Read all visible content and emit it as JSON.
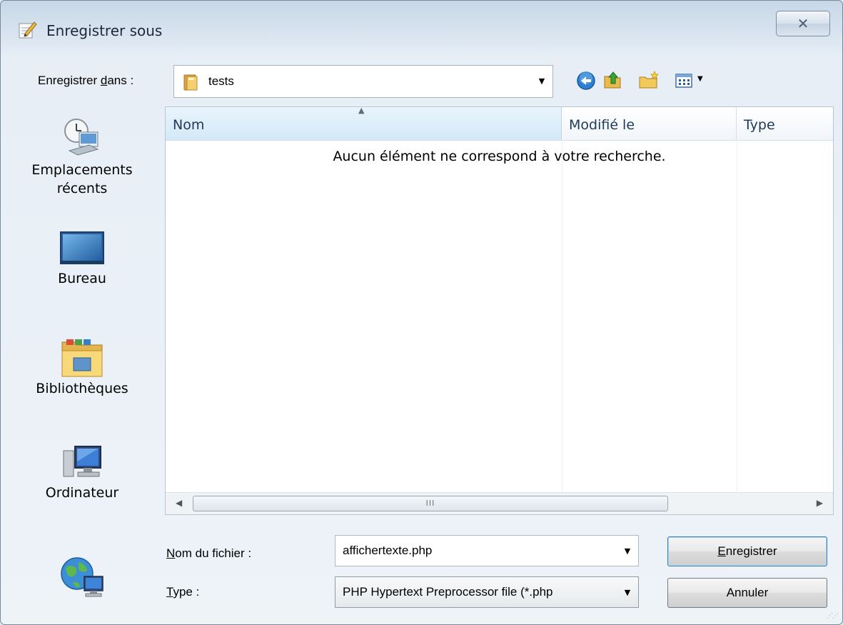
{
  "window": {
    "title": "Enregistrer sous",
    "close_glyph": "✕"
  },
  "location": {
    "label_pre": "Enregistrer ",
    "label_accel": "d",
    "label_post": "ans :",
    "value": "tests",
    "toolbar_icons": [
      "back-icon",
      "up-folder-icon",
      "new-folder-icon",
      "views-icon"
    ]
  },
  "places": [
    {
      "label_line1": "Emplacements",
      "label_line2": "récents",
      "icon": "recent-places-icon"
    },
    {
      "label_line1": "Bureau",
      "label_line2": "",
      "icon": "desktop-icon"
    },
    {
      "label_line1": "Bibliothèques",
      "label_line2": "",
      "icon": "libraries-icon"
    },
    {
      "label_line1": "Ordinateur",
      "label_line2": "",
      "icon": "computer-icon"
    },
    {
      "label_line1": "",
      "label_line2": "",
      "icon": "network-icon"
    }
  ],
  "filelist": {
    "columns": [
      "Nom",
      "Modifié le",
      "Type"
    ],
    "empty_message": "Aucun élément ne correspond à votre recherche.",
    "scroll_thumb_grip": "III"
  },
  "form": {
    "filename_label_accel": "N",
    "filename_label_rest": "om du fichier :",
    "filename_value": "affichertexte.php",
    "type_label_accel": "T",
    "type_label_rest": "ype :",
    "type_value": "PHP Hypertext Preprocessor file (*.php"
  },
  "buttons": {
    "save_accel": "E",
    "save_rest": "nregistrer",
    "cancel": "Annuler"
  },
  "colors": {
    "accent": "#3c7fb1",
    "header_selected": "#d3e9f8",
    "column_text": "#1e395b"
  }
}
